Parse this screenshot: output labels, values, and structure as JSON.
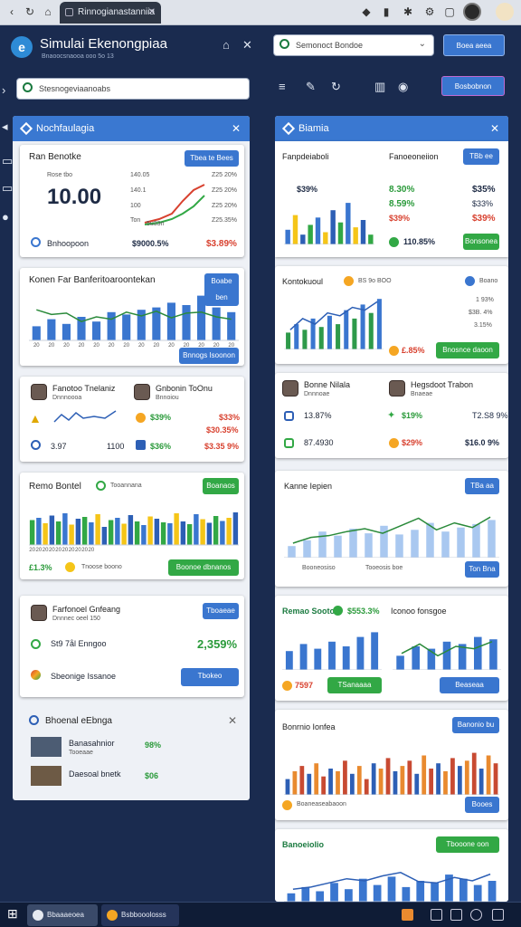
{
  "browser": {
    "tab_title": "Rinnogianastanniia"
  },
  "app": {
    "title": "Simulai Ekenongpiaa",
    "subtitle": "Bnaoocsnaooa ooo 5o 13"
  },
  "search": {
    "placeholder": "Stesnogeviaanoabs",
    "right_placeholder": "Semonoct Bondoe",
    "button": "Boea aeea",
    "right_button2": "Bosbobnon"
  },
  "left": {
    "panel": {
      "title": "Nochfaulagia"
    },
    "c1": {
      "title": "Ran Benotke",
      "button": "Tbea te Bees",
      "big": "10.00",
      "labels": [
        "Rose tbo",
        "140.05",
        "140.1",
        "100",
        "Ton"
      ],
      "rlabels": [
        "Z25 20%",
        "Z25 20%",
        "Z25 20%",
        "Z25.35%"
      ],
      "footer": "Bnhoopoon",
      "val1": "$9000.5%",
      "val2": "$3.89%",
      "charttag": "5u33n"
    },
    "c2": {
      "title": "Konen Far Banferitoaroontekan",
      "button": "Boabe ben",
      "button2": "Bnnogs Isoonon",
      "xlabels": [
        "20",
        "20",
        "20",
        "20",
        "20",
        "20",
        "20",
        "20",
        "20",
        "20",
        "20",
        "20",
        "20",
        "20"
      ],
      "values": [
        30,
        45,
        35,
        50,
        40,
        60,
        55,
        65,
        70,
        80,
        75,
        95,
        70,
        60
      ],
      "line": [
        65,
        55,
        58,
        40,
        50,
        45,
        60,
        52,
        62,
        48,
        58,
        60,
        50,
        45
      ]
    },
    "c3": {
      "name1": "Fanotoo Tnelaniz",
      "name1sub": "Dnnnoooa",
      "name2": "Gnbonin ToOnu",
      "name2sub": "Bnnoiou",
      "v1": "$39%",
      "v2": "$33%",
      "v3": "$30.35%",
      "r1": "3.97",
      "r2": "1100",
      "v4": "$36%",
      "v5": "$3.35 9%"
    },
    "c4": {
      "title": "Remo Bontel",
      "tag": "Tooannana",
      "button": "Boanaos",
      "footer_val": "£1.3%",
      "footer_lbl": "Tnoose boono",
      "button2": "Boonoe dbnanos",
      "xlabels": [
        "20",
        "20",
        "20",
        "20",
        "20",
        "20",
        "20",
        "20",
        "20",
        "20"
      ],
      "values": [
        55,
        60,
        48,
        65,
        52,
        70,
        45,
        58,
        62,
        50,
        68,
        40,
        55,
        60,
        47,
        66,
        52,
        44,
        63,
        58,
        50,
        48,
        70,
        52,
        46,
        68,
        57,
        49,
        64,
        53,
        60,
        72
      ]
    },
    "c5": {
      "name": "Farfonoel Gnfeang",
      "sub": "Dnnnec oeel 150",
      "button": "Tboaeae",
      "row1": "St9 7ål Enngoo",
      "big": "2,359%",
      "row2": "Sbeonige Issanoe",
      "button2": "Tbokeo"
    },
    "c6": {
      "title": "Bhoenal eEbnga",
      "i1": "Banasahnior",
      "i1sub": "Tooeaae",
      "i1val": "98%",
      "i2": "Daesoal bnetk",
      "i2val": "$06"
    }
  },
  "right": {
    "panel": {
      "title": "Biamia"
    },
    "r1": {
      "title": "Fanpdeiaboli",
      "title2": "Fanoeoneiion",
      "button": "TBb ee",
      "kpi": "$39%",
      "vals": [
        "8.30%",
        "8.59%",
        "$39%"
      ],
      "vals2": [
        "$35%",
        "$33%",
        "$39%"
      ],
      "footer": "110.85%",
      "button2": "Bonsonea",
      "values": [
        30,
        60,
        20,
        40,
        55,
        25,
        70,
        45,
        85,
        35,
        50,
        20
      ]
    },
    "r2": {
      "title": "Kontokuoul",
      "tag": "BS 9o BOO",
      "sub": "Boano",
      "vals": [
        "1 93%",
        "$3B. 4%",
        "3.15%"
      ],
      "footer": "£.85%",
      "button": "Bnosnce daoon",
      "values": [
        30,
        45,
        35,
        55,
        40,
        60,
        45,
        70,
        55,
        80,
        65,
        90
      ],
      "line": [
        35,
        55,
        45,
        65,
        60,
        75,
        70,
        85
      ]
    },
    "r3": {
      "name1": "Bonne Nilala",
      "name1sub": "Dnnnoae",
      "name2": "Hegsdoot Trabon",
      "name2sub": "Bnaeae",
      "v1": "13.87%",
      "v2": "87.4930",
      "v3": "$19%",
      "v4": "$29%",
      "v5": "T2.S8 9%",
      "v6": "$16.0 9%"
    },
    "r4": {
      "title": "Kanne Iepien",
      "button": "TBa aa",
      "button2": "Ton Bna",
      "footer": "Booneosiso",
      "footer2": "Tooeosis boe",
      "values": [
        20,
        30,
        45,
        38,
        50,
        42,
        55,
        40,
        48,
        60,
        45,
        52,
        58,
        65
      ],
      "line": [
        25,
        35,
        38,
        45,
        50,
        42,
        55,
        68,
        48,
        60,
        52,
        70
      ]
    },
    "r5": {
      "title": "Remao Sooto",
      "tag": "$553.3%",
      "title2": "Iconoo fonsgoe",
      "footer": "7597",
      "button": "TSanaaaa",
      "button2": "Beaseaa",
      "values": [
        40,
        55,
        45,
        60,
        50,
        70,
        80
      ],
      "values2": [
        30,
        50,
        45,
        60,
        55,
        70,
        65
      ],
      "line": [
        35,
        55,
        30,
        50,
        45,
        60
      ]
    },
    "r6": {
      "title": "Bonrnio Ionfea",
      "button": "Banonio bu",
      "footer": "Boaneaseabaoon",
      "button2": "Booes",
      "values": [
        30,
        45,
        55,
        40,
        60,
        35,
        50,
        45,
        65,
        40,
        55,
        30,
        60,
        50,
        70,
        45,
        55,
        65,
        40,
        75,
        50,
        60,
        45,
        70,
        55,
        65,
        80,
        50,
        75,
        60
      ]
    },
    "r7": {
      "title": "Banoeiolio",
      "button": "Tbooone oon",
      "values": [
        20,
        35,
        25,
        45,
        30,
        55,
        40,
        60,
        35,
        50,
        45,
        65,
        55,
        40,
        50
      ],
      "line": [
        30,
        35,
        45,
        55,
        50,
        62,
        70,
        48,
        45,
        58,
        50,
        66
      ]
    }
  },
  "taskbar": {
    "t1": "Bbaaaeoea",
    "t2": "Bsbbooolosss"
  }
}
